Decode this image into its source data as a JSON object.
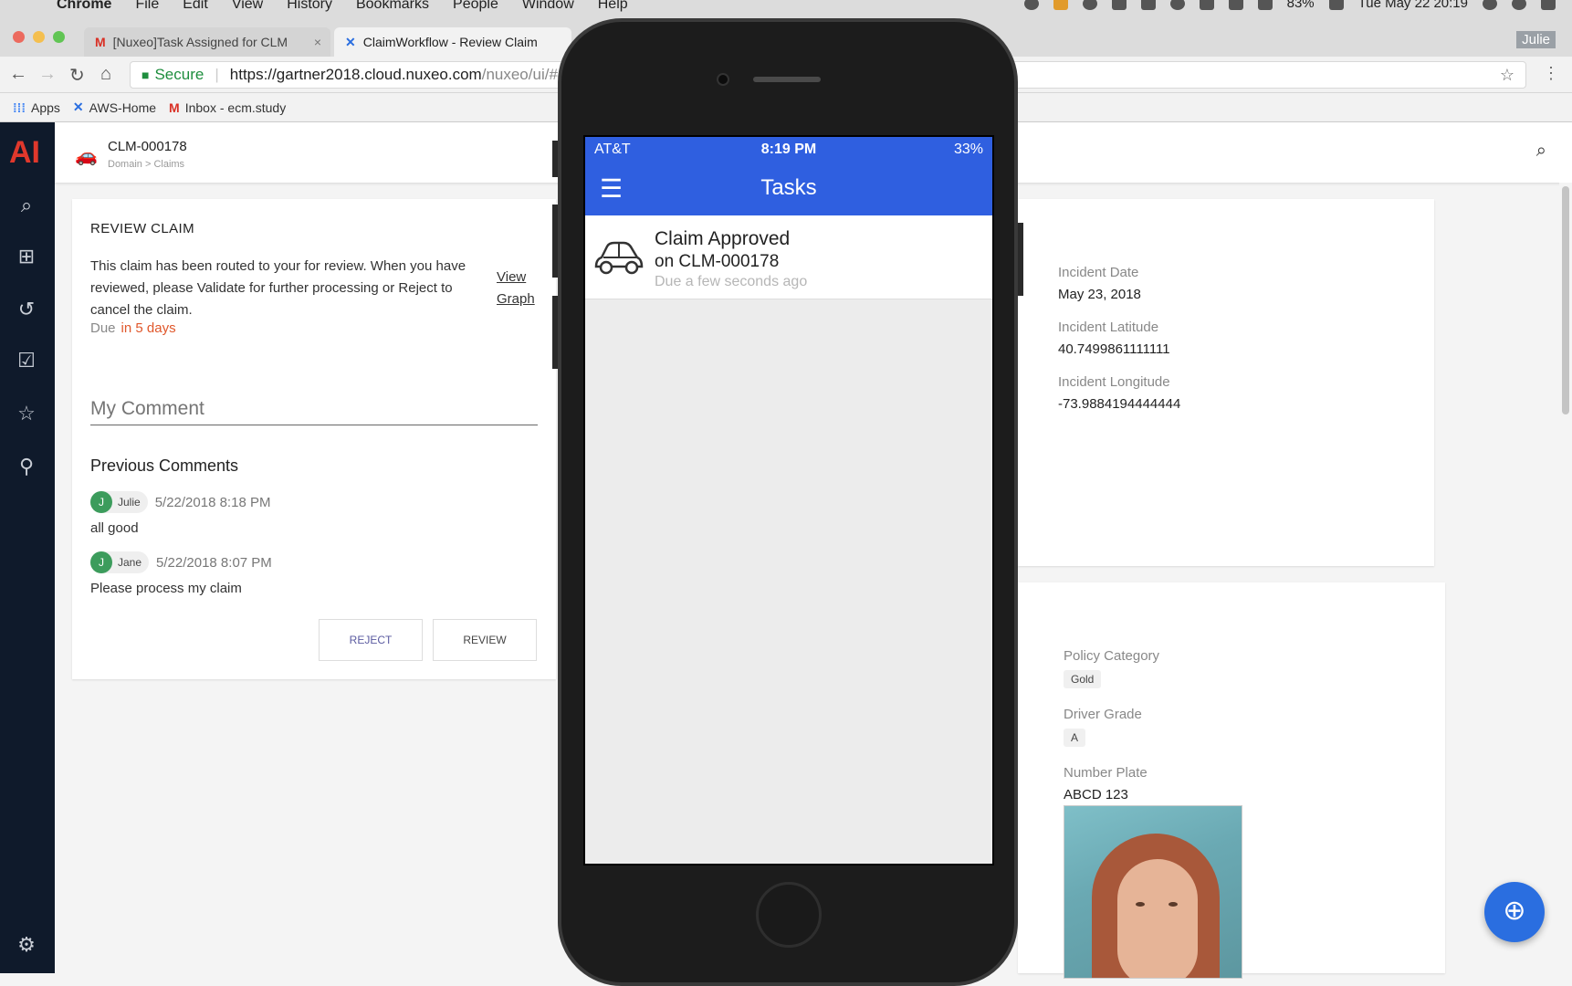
{
  "menubar": {
    "app": "Chrome",
    "items": [
      "File",
      "Edit",
      "View",
      "History",
      "Bookmarks",
      "People",
      "Window",
      "Help"
    ],
    "battery": "83%",
    "datetime": "Tue May 22  20:19"
  },
  "browser": {
    "tabs": [
      {
        "title": "[Nuxeo]Task Assigned for CLM",
        "icon": "gmail-icon"
      },
      {
        "title": "ClaimWorkflow - Review Claim",
        "icon": "nuxeo-icon"
      }
    ],
    "profile": "Julie",
    "secure_label": "Secure",
    "url_host": "https://gartner2018.cloud.nuxeo.com",
    "url_path": "/nuxeo/ui/#",
    "bookmarks": [
      {
        "label": "Apps",
        "icon": "apps-grid-icon"
      },
      {
        "label": "AWS-Home",
        "icon": "nuxeo-icon"
      },
      {
        "label": "Inbox - ecm.study",
        "icon": "gmail-icon"
      }
    ]
  },
  "app": {
    "logo": "AI",
    "document_id": "CLM-000178",
    "breadcrumb": "Domain > Claims"
  },
  "review": {
    "heading": "REVIEW CLAIM",
    "description": "This claim has been routed to your for review. When you have reviewed, please Validate for further processing or Reject to cancel the claim.",
    "view_graph": "View Graph",
    "due_label": "Due",
    "due_value": "in 5 days",
    "comment_placeholder": "My Comment",
    "previous_heading": "Previous Comments",
    "comments": [
      {
        "initial": "J",
        "author": "Julie",
        "date": "5/22/2018 8:18 PM",
        "text": "all good"
      },
      {
        "initial": "J",
        "author": "Jane",
        "date": "5/22/2018 8:07 PM",
        "text": "Please process my claim"
      }
    ],
    "reject_label": "REJECT",
    "review_label": "REVIEW"
  },
  "incident": {
    "date_label": "Incident Date",
    "date_value": "May 23, 2018",
    "lat_label": "Incident Latitude",
    "lat_value": "40.7499861111111",
    "lon_label": "Incident Longitude",
    "lon_value": "-73.9884194444444"
  },
  "policy": {
    "category_label": "Policy Category",
    "category_value": "Gold",
    "grade_label": "Driver Grade",
    "grade_value": "A",
    "plate_label": "Number Plate",
    "plate_value": "ABCD 123"
  },
  "phone": {
    "carrier": "AT&T",
    "time": "8:19 PM",
    "battery": "33%",
    "title": "Tasks",
    "task": {
      "title": "Claim Approved",
      "subtitle": "on CLM-000178",
      "due": "Due a few seconds ago"
    }
  }
}
